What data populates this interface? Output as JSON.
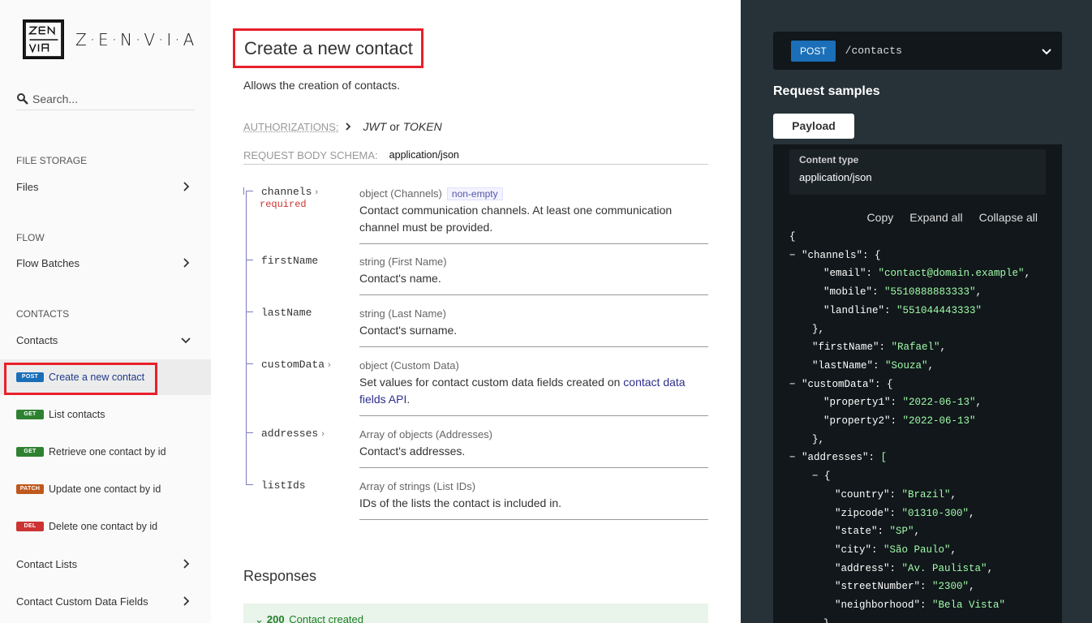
{
  "brand": {
    "name": "Z·E·N·V·I·A"
  },
  "search": {
    "placeholder": "Search..."
  },
  "sidebar": {
    "sections": [
      {
        "label": "FILE STORAGE",
        "items": [
          {
            "label": "Files"
          }
        ]
      },
      {
        "label": "FLOW",
        "items": [
          {
            "label": "Flow Batches"
          }
        ]
      },
      {
        "label": "CONTACTS",
        "items": [
          {
            "label": "Contacts"
          }
        ]
      }
    ],
    "operations": [
      {
        "method": "POST",
        "label": "Create a new contact",
        "active": true
      },
      {
        "method": "GET",
        "label": "List contacts"
      },
      {
        "method": "GET",
        "label": "Retrieve one contact by id"
      },
      {
        "method": "PATCH",
        "label": "Update one contact by id"
      },
      {
        "method": "DEL",
        "label": "Delete one contact by id"
      }
    ],
    "more_items": [
      {
        "label": "Contact Lists"
      },
      {
        "label": "Contact Custom Data Fields"
      }
    ]
  },
  "main": {
    "title": "Create a new contact",
    "description": "Allows the creation of contacts.",
    "authorizations_label": "AUTHORIZATIONS:",
    "auth_jwt": "JWT",
    "auth_or": "or",
    "auth_token": "TOKEN",
    "request_body_label": "REQUEST BODY SCHEMA:",
    "request_body_type": "application/json",
    "fields": [
      {
        "name": "channels",
        "expandable": true,
        "required": "required",
        "type": "object (Channels)",
        "tag": "non-empty",
        "desc": "Contact communication channels. At least one communication channel must be provided."
      },
      {
        "name": "firstName",
        "type": "string (First Name)",
        "desc": "Contact's name."
      },
      {
        "name": "lastName",
        "type": "string (Last Name)",
        "desc": "Contact's surname."
      },
      {
        "name": "customData",
        "expandable": true,
        "type": "object (Custom Data)",
        "desc": "Set values for contact custom data fields created on ",
        "link": "contact data fields API",
        "desc_end": "."
      },
      {
        "name": "addresses",
        "expandable": true,
        "type": "Array of objects (Addresses)",
        "desc": "Contact's addresses."
      },
      {
        "name": "listIds",
        "type": "Array of strings (List IDs)",
        "desc": "IDs of the lists the contact is included in."
      }
    ],
    "responses_heading": "Responses",
    "response_200": {
      "code": "200",
      "label": "Contact created"
    }
  },
  "right": {
    "method": "POST",
    "path": "/contacts",
    "request_samples": "Request samples",
    "payload_tab": "Payload",
    "content_type_label": "Content type",
    "content_type_value": "application/json",
    "actions": {
      "copy": "Copy",
      "expand": "Expand all",
      "collapse": "Collapse all"
    },
    "code_lines": [
      {
        "indent": 0,
        "t": "{"
      },
      {
        "indent": 1,
        "tog": "−",
        "k": "\"channels\"",
        "p": ": {"
      },
      {
        "indent": 3,
        "k": "\"email\"",
        "p": ": ",
        "s": "\"contact@domain.example\"",
        "e": ","
      },
      {
        "indent": 3,
        "k": "\"mobile\"",
        "p": ": ",
        "s": "\"5510888883333\"",
        "e": ","
      },
      {
        "indent": 3,
        "k": "\"landline\"",
        "p": ": ",
        "s": "\"551044443333\""
      },
      {
        "indent": 2,
        "t": "},"
      },
      {
        "indent": 2,
        "k": "\"firstName\"",
        "p": ": ",
        "s": "\"Rafael\"",
        "e": ","
      },
      {
        "indent": 2,
        "k": "\"lastName\"",
        "p": ": ",
        "s": "\"Souza\"",
        "e": ","
      },
      {
        "indent": 1,
        "tog": "−",
        "k": "\"customData\"",
        "p": ": {"
      },
      {
        "indent": 3,
        "k": "\"property1\"",
        "p": ": ",
        "s": "\"2022-06-13\"",
        "e": ","
      },
      {
        "indent": 3,
        "k": "\"property2\"",
        "p": ": ",
        "s": "\"2022-06-13\""
      },
      {
        "indent": 2,
        "t": "},"
      },
      {
        "indent": 1,
        "tog": "−",
        "k": "\"addresses\"",
        "p": ": ",
        "s": "["
      },
      {
        "indent": 3,
        "tog": "−",
        "t": "{"
      },
      {
        "indent": 4,
        "k": "\"country\"",
        "p": ": ",
        "s": "\"Brazil\"",
        "e": ","
      },
      {
        "indent": 4,
        "k": "\"zipcode\"",
        "p": ": ",
        "s": "\"01310-300\"",
        "e": ","
      },
      {
        "indent": 4,
        "k": "\"state\"",
        "p": ": ",
        "s": "\"SP\"",
        "e": ","
      },
      {
        "indent": 4,
        "k": "\"city\"",
        "p": ": ",
        "s": "\"São Paulo\"",
        "e": ","
      },
      {
        "indent": 4,
        "k": "\"address\"",
        "p": ": ",
        "s": "\"Av. Paulista\"",
        "e": ","
      },
      {
        "indent": 4,
        "k": "\"streetNumber\"",
        "p": ": ",
        "s": "\"2300\"",
        "e": ","
      },
      {
        "indent": 4,
        "k": "\"neighborhood\"",
        "p": ": ",
        "s": "\"Bela Vista\""
      },
      {
        "indent": 3,
        "t": "}"
      }
    ]
  }
}
